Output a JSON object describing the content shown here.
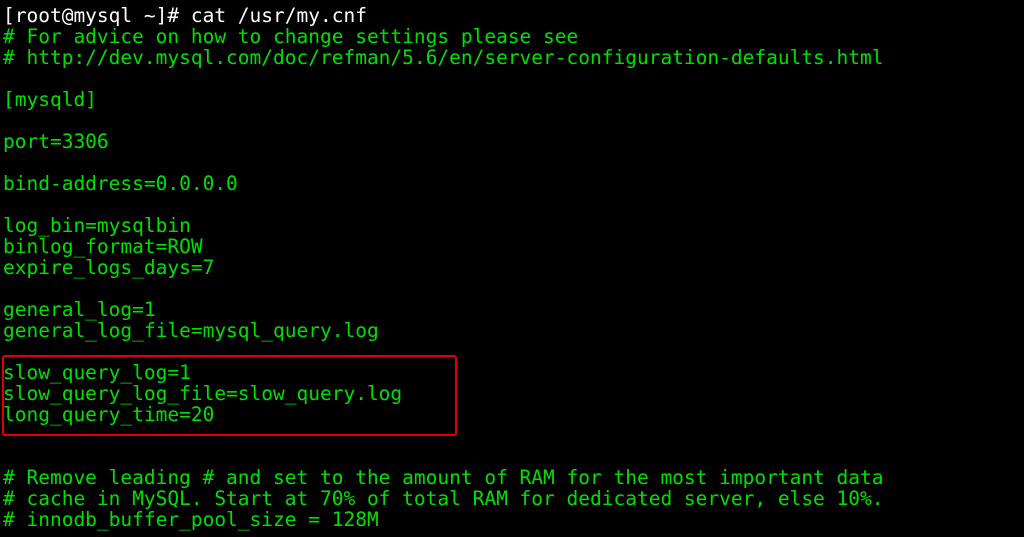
{
  "terminal": {
    "prompt_line": "[root@mysql ~]# cat /usr/my.cnf",
    "lines": [
      "# For advice on how to change settings please see",
      "# http://dev.mysql.com/doc/refman/5.6/en/server-configuration-defaults.html",
      "[mysqld]",
      "port=3306",
      "bind-address=0.0.0.0",
      "log_bin=mysqlbin",
      "binlog_format=ROW",
      "expire_logs_days=7",
      "general_log=1",
      "general_log_file=mysql_query.log",
      "slow_query_log=1",
      "slow_query_log_file=slow_query.log",
      "long_query_time=20",
      "# Remove leading # and set to the amount of RAM for the most important data",
      "# cache in MySQL. Start at 70% of total RAM for dedicated server, else 10%.",
      "# innodb_buffer_pool_size = 128M"
    ]
  },
  "colors": {
    "background": "#000000",
    "text": "#00e000",
    "prompt": "#ffffff",
    "highlight_border": "#e00000"
  }
}
